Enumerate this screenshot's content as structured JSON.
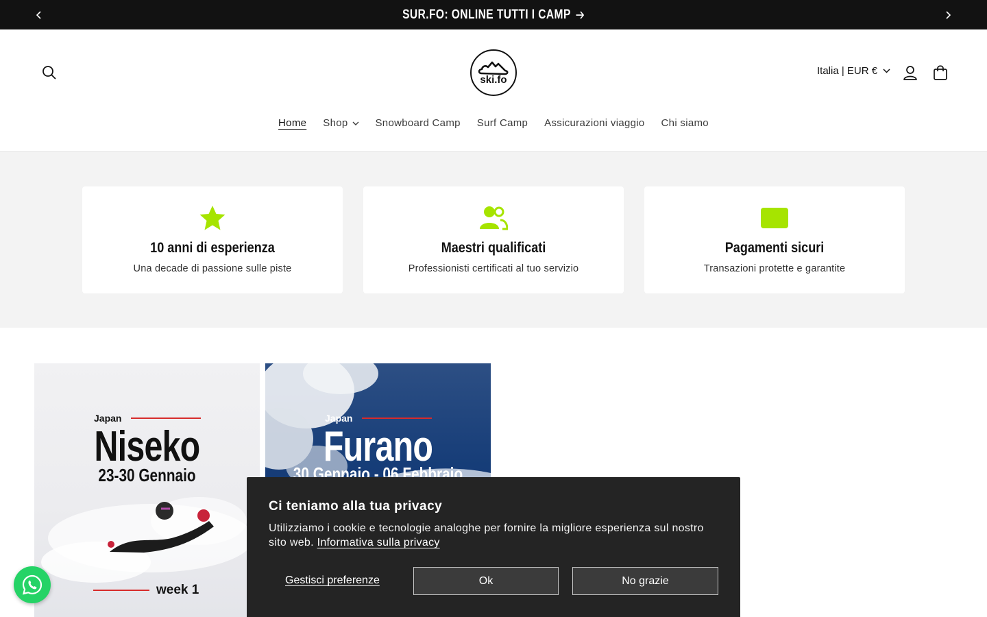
{
  "announcement": {
    "message": "SUR.FO: ONLINE TUTTI I CAMP",
    "prev_icon": "chevron-left-icon",
    "next_icon": "chevron-right-icon",
    "arrow_icon": "arrow-right-icon"
  },
  "header": {
    "logo_text": "ski.fo",
    "country_selector": "Italia | EUR €",
    "icons": [
      "search-icon",
      "account-icon",
      "cart-icon"
    ]
  },
  "nav": {
    "items": [
      {
        "label": "Home",
        "active": true
      },
      {
        "label": "Shop",
        "has_dropdown": true
      },
      {
        "label": "Snowboard Camp"
      },
      {
        "label": "Surf Camp"
      },
      {
        "label": "Assicurazioni viaggio"
      },
      {
        "label": "Chi siamo"
      }
    ]
  },
  "features": [
    {
      "icon": "star-icon",
      "title": "10 anni di esperienza",
      "subtitle": "Una decade di passione sulle piste"
    },
    {
      "icon": "users-icon",
      "title": "Maestri qualificati",
      "subtitle": "Professionisti certificati al tuo servizio"
    },
    {
      "icon": "card-icon",
      "title": "Pagamenti sicuri",
      "subtitle": "Transazioni protette e garantite"
    }
  ],
  "products": [
    {
      "country": "Japan",
      "name": "Niseko",
      "dates": "23-30 Gennaio",
      "week": "week 1"
    },
    {
      "country": "Japan",
      "name": "Furano",
      "dates": "30 Gennaio - 06 Febbraio"
    }
  ],
  "cookie": {
    "title": "Ci teniamo alla tua privacy",
    "text": "Utilizziamo i cookie e tecnologie analoghe per fornire la migliore esperienza sul nostro sito web.",
    "link": "Informativa sulla privacy",
    "manage": "Gestisci preferenze",
    "ok": "Ok",
    "decline": "No grazie"
  },
  "colors": {
    "accent_green": "#a6e400",
    "dark": "#121212",
    "whatsapp": "#25d366",
    "cookie_bg": "#242424"
  }
}
